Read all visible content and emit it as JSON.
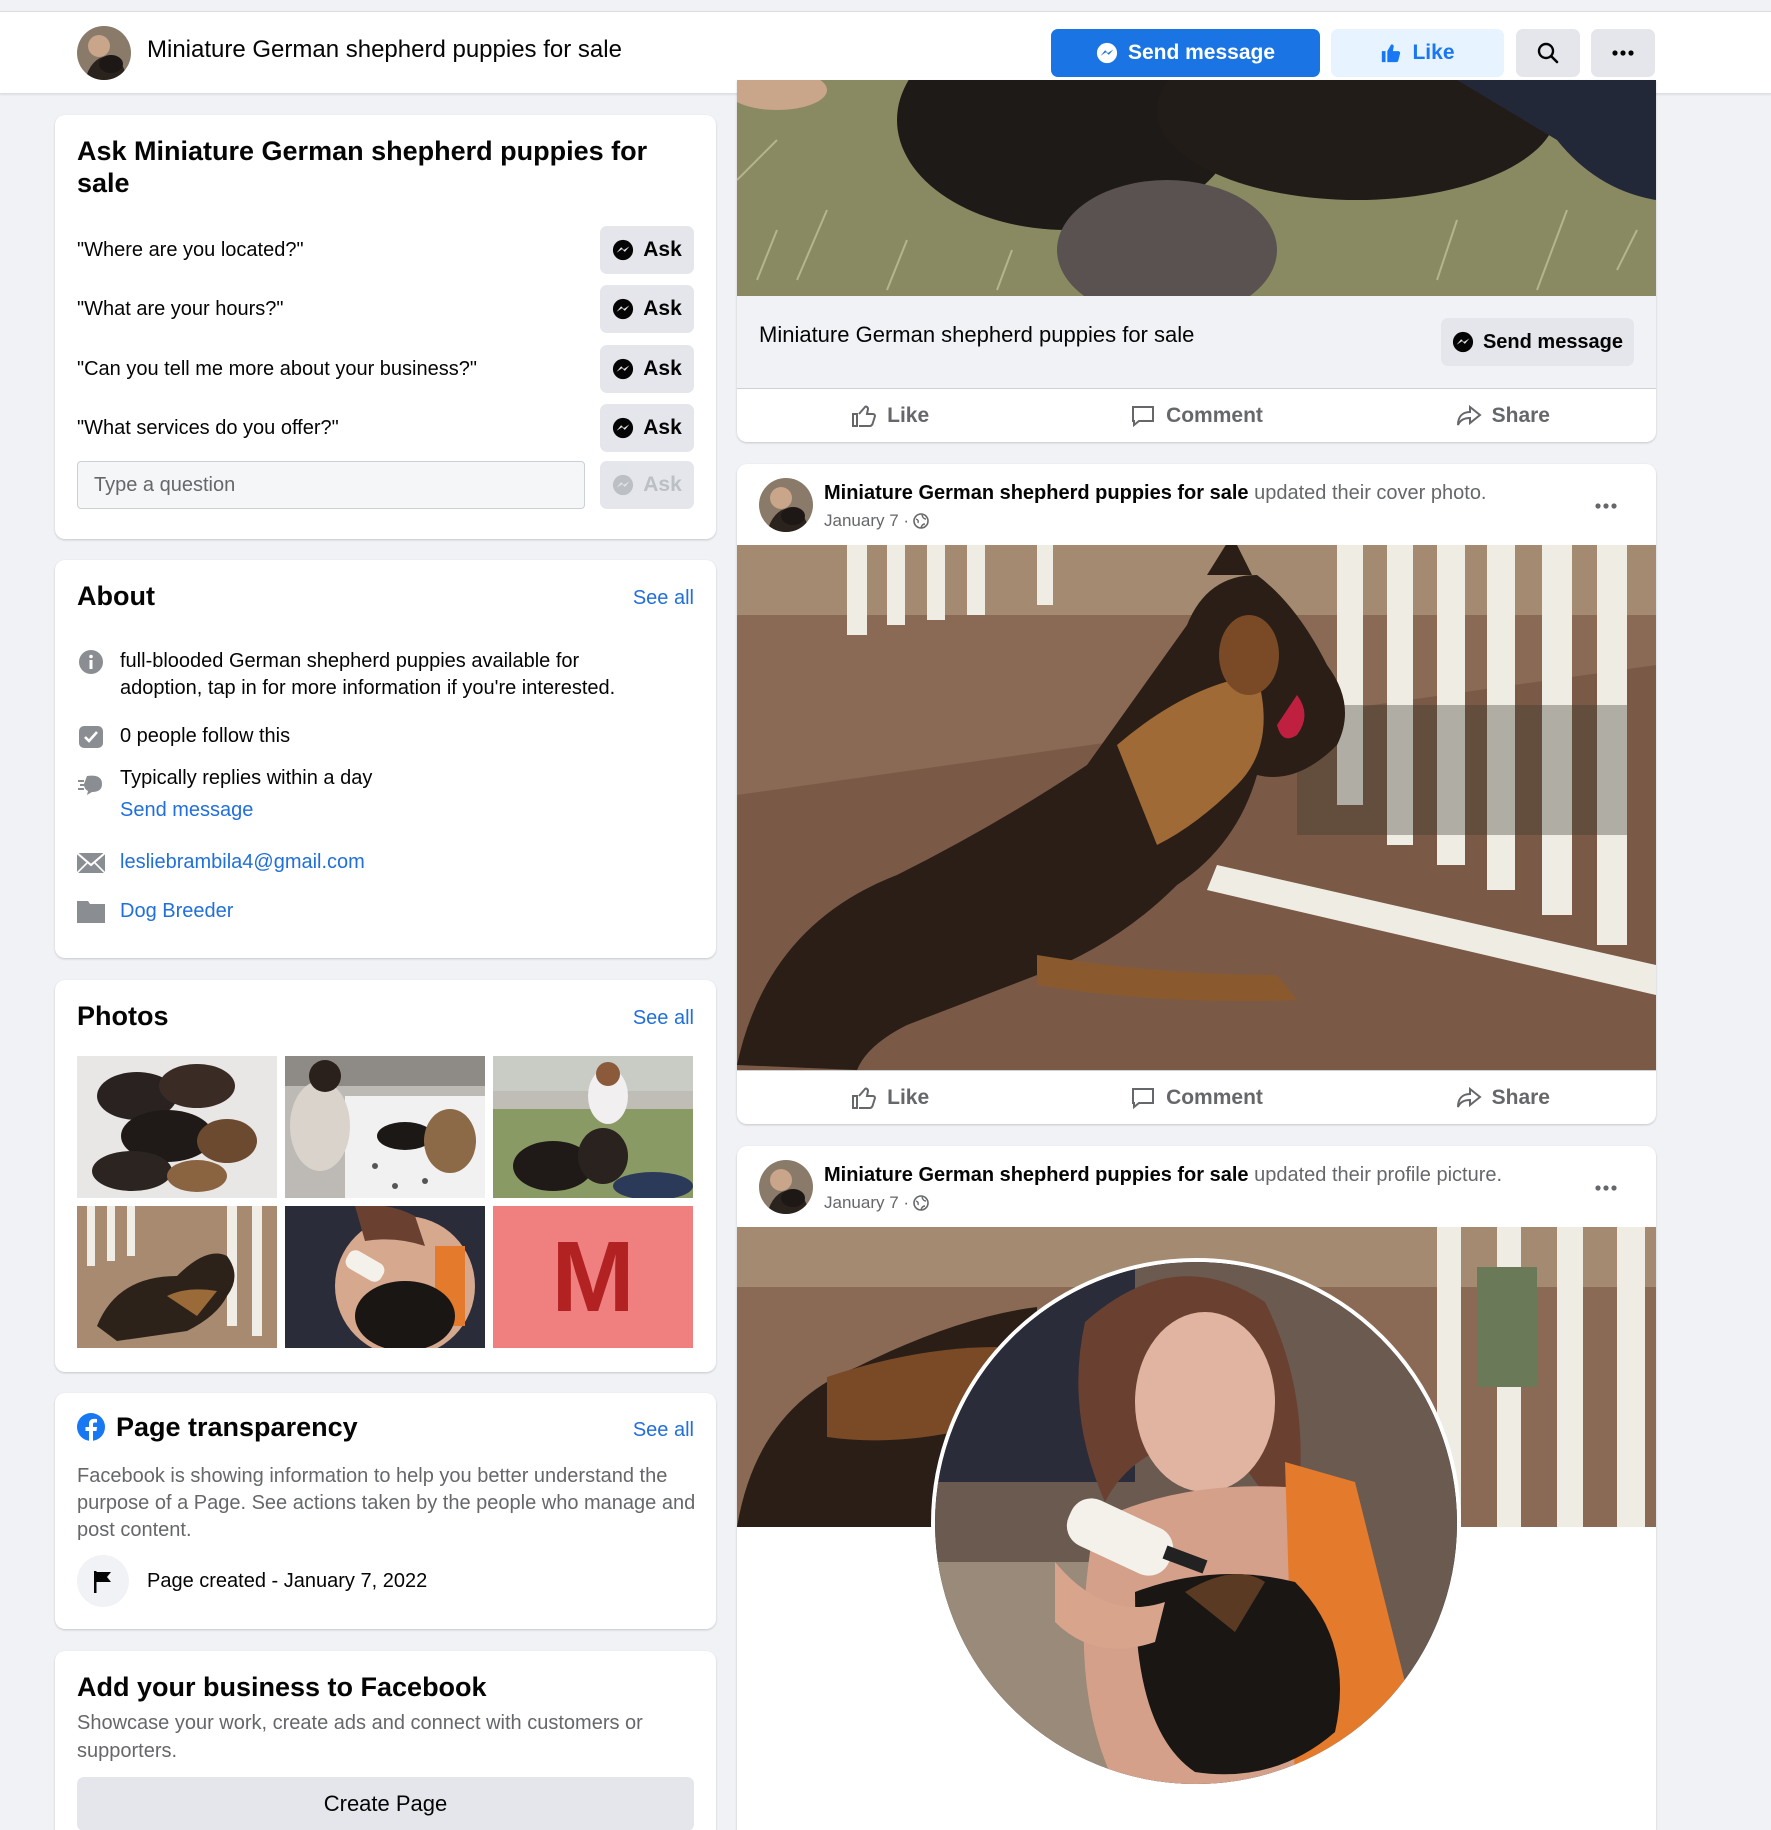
{
  "header": {
    "title": "Miniature German shepherd puppies for sale",
    "send_message": "Send message",
    "like": "Like",
    "search_icon": "search-icon",
    "more_icon": "more-icon"
  },
  "ask": {
    "title": "Ask Miniature German shepherd puppies for sale",
    "questions": [
      "\"Where are you located?\"",
      "\"What are your hours?\"",
      "\"Can you tell me more about your business?\"",
      "\"What services do you offer?\""
    ],
    "ask_label": "Ask",
    "placeholder": "Type a question"
  },
  "about": {
    "title": "About",
    "see_all": "See all",
    "description": "full-blooded German shepherd puppies available for adoption, tap in for more information if you're interested.",
    "followers": "0 people follow this",
    "replies": "Typically replies within a day",
    "send_message": "Send message",
    "email": "lesliebrambila4@gmail.com",
    "category": "Dog Breeder"
  },
  "photos": {
    "title": "Photos",
    "see_all": "See all",
    "letter_tile": "M"
  },
  "transparency": {
    "title": "Page transparency",
    "see_all": "See all",
    "text": "Facebook is showing information to help you better understand the purpose of a Page. See actions taken by the people who manage and post content.",
    "created": "Page created - January 7, 2022"
  },
  "business": {
    "title": "Add your business to Facebook",
    "text": "Showcase your work, create ads and connect with customers or supporters.",
    "button": "Create Page"
  },
  "feed": {
    "cover_title": "Miniature German shepherd puppies for sale",
    "send_message": "Send message",
    "actions": {
      "like": "Like",
      "comment": "Comment",
      "share": "Share"
    },
    "posts": [
      {
        "author": "Miniature German shepherd puppies for sale",
        "action": "updated their cover photo.",
        "date": "January 7 ·"
      },
      {
        "author": "Miniature German shepherd puppies for sale",
        "action": "updated their profile picture.",
        "date": "January 7 ·"
      }
    ]
  },
  "colors": {
    "brand_blue": "#1b74e4",
    "link_blue": "#216fdb",
    "background": "#f0f2f5",
    "letter_tile_bg": "#f08080",
    "letter_tile_fg": "#b22222"
  }
}
